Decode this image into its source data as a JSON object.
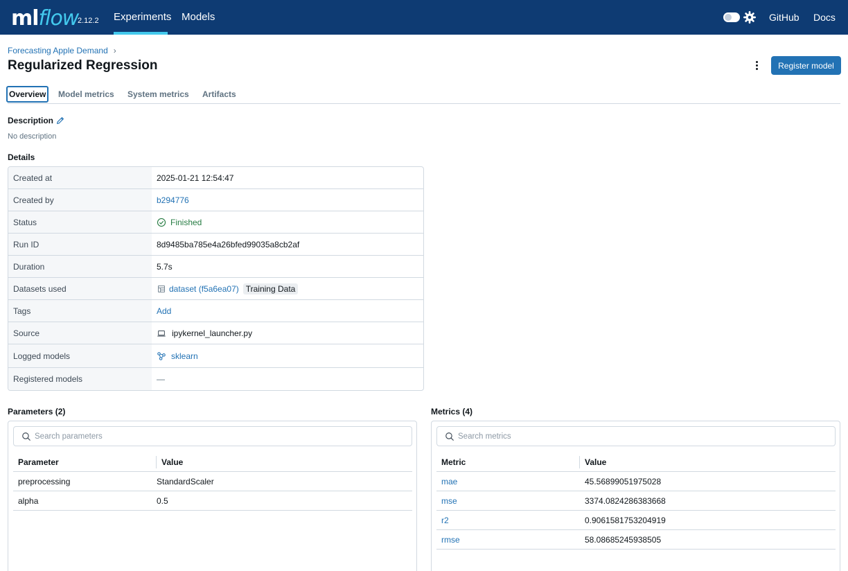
{
  "header": {
    "logo_ml": "ml",
    "logo_flow": "flow",
    "version": "2.12.2",
    "nav": {
      "experiments": "Experiments",
      "models": "Models",
      "github": "GitHub",
      "docs": "Docs"
    },
    "icons": [
      "theme-toggle-icon",
      "gear-icon"
    ]
  },
  "breadcrumb": {
    "experiment": "Forecasting Apple Demand",
    "separator": "›"
  },
  "page": {
    "title": "Regularized Regression",
    "register_label": "Register model"
  },
  "tabs": [
    "Overview",
    "Model metrics",
    "System metrics",
    "Artifacts"
  ],
  "description": {
    "title": "Description",
    "value": "No description"
  },
  "details": {
    "title": "Details",
    "rows": {
      "created_at": {
        "key": "Created at",
        "value": "2025-01-21 12:54:47"
      },
      "created_by": {
        "key": "Created by",
        "value": "b294776"
      },
      "status": {
        "key": "Status",
        "value": "Finished"
      },
      "run_id": {
        "key": "Run ID",
        "value": "8d9485ba785e4a26bfed99035a8cb2af"
      },
      "duration": {
        "key": "Duration",
        "value": "5.7s"
      },
      "datasets": {
        "key": "Datasets used",
        "value": "dataset (f5a6ea07)",
        "tag": "Training Data"
      },
      "tags": {
        "key": "Tags",
        "value": "Add"
      },
      "source": {
        "key": "Source",
        "value": "ipykernel_launcher.py"
      },
      "logged_models": {
        "key": "Logged models",
        "value": "sklearn"
      },
      "registered_models": {
        "key": "Registered models",
        "value": "—"
      }
    }
  },
  "parameters": {
    "title": "Parameters (2)",
    "search_placeholder": "Search parameters",
    "columns": [
      "Parameter",
      "Value"
    ],
    "rows": [
      [
        "preprocessing",
        "StandardScaler"
      ],
      [
        "alpha",
        "0.5"
      ]
    ]
  },
  "metrics": {
    "title": "Metrics (4)",
    "search_placeholder": "Search metrics",
    "columns": [
      "Metric",
      "Value"
    ],
    "rows": [
      [
        "mae",
        "45.56899051975028"
      ],
      [
        "mse",
        "3374.0824286383668"
      ],
      [
        "r2",
        "0.9061581753204919"
      ],
      [
        "rmse",
        "58.08685245938505"
      ]
    ]
  },
  "colors": {
    "header_bg": "#0e3b73",
    "accent": "#43c9ed",
    "primary": "#2272b4",
    "success": "#277c43"
  }
}
